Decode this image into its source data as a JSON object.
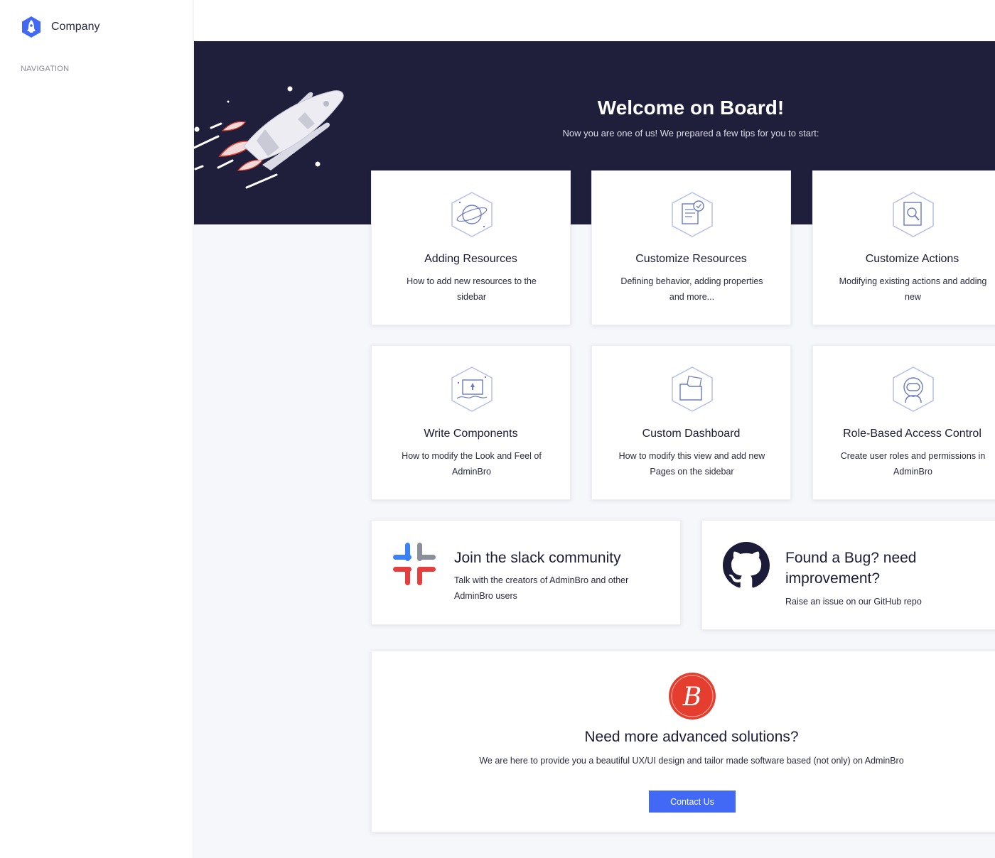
{
  "sidebar": {
    "brand_name": "Company",
    "nav_heading": "NAVIGATION"
  },
  "hero": {
    "title": "Welcome on Board!",
    "subtitle": "Now you are one of us! We prepared a few tips for you to start:"
  },
  "tips": [
    {
      "title": "Adding Resources",
      "description": "How to add new resources to the sidebar",
      "icon": "planet-icon"
    },
    {
      "title": "Customize Resources",
      "description": "Defining behavior, adding properties and more...",
      "icon": "document-check-icon"
    },
    {
      "title": "Customize Actions",
      "description": "Modifying existing actions and adding new",
      "icon": "search-document-icon"
    },
    {
      "title": "Write Components",
      "description": "How to modify the Look and Feel of AdminBro",
      "icon": "rocket-screen-icon"
    },
    {
      "title": "Custom Dashboard",
      "description": "How to modify this view and add new Pages on the sidebar",
      "icon": "folder-icon"
    },
    {
      "title": "Role-Based Access Control",
      "description": "Create user roles and permissions in AdminBro",
      "icon": "astronaut-icon"
    }
  ],
  "community": {
    "slack_title": "Join the slack community",
    "slack_desc": "Talk with the creators of AdminBro and other AdminBro users",
    "github_title": "Found a Bug? need improvement?",
    "github_desc": "Raise an issue on our GitHub repo"
  },
  "advanced": {
    "title": "Need more advanced solutions?",
    "description": "We are here to provide you a beautiful UX/UI design and tailor made software based (not only) on AdminBro",
    "button_label": "Contact Us"
  },
  "colors": {
    "hero_bg": "#1f1f3c",
    "primary": "#4268f6",
    "brand_red": "#e53e2f"
  }
}
